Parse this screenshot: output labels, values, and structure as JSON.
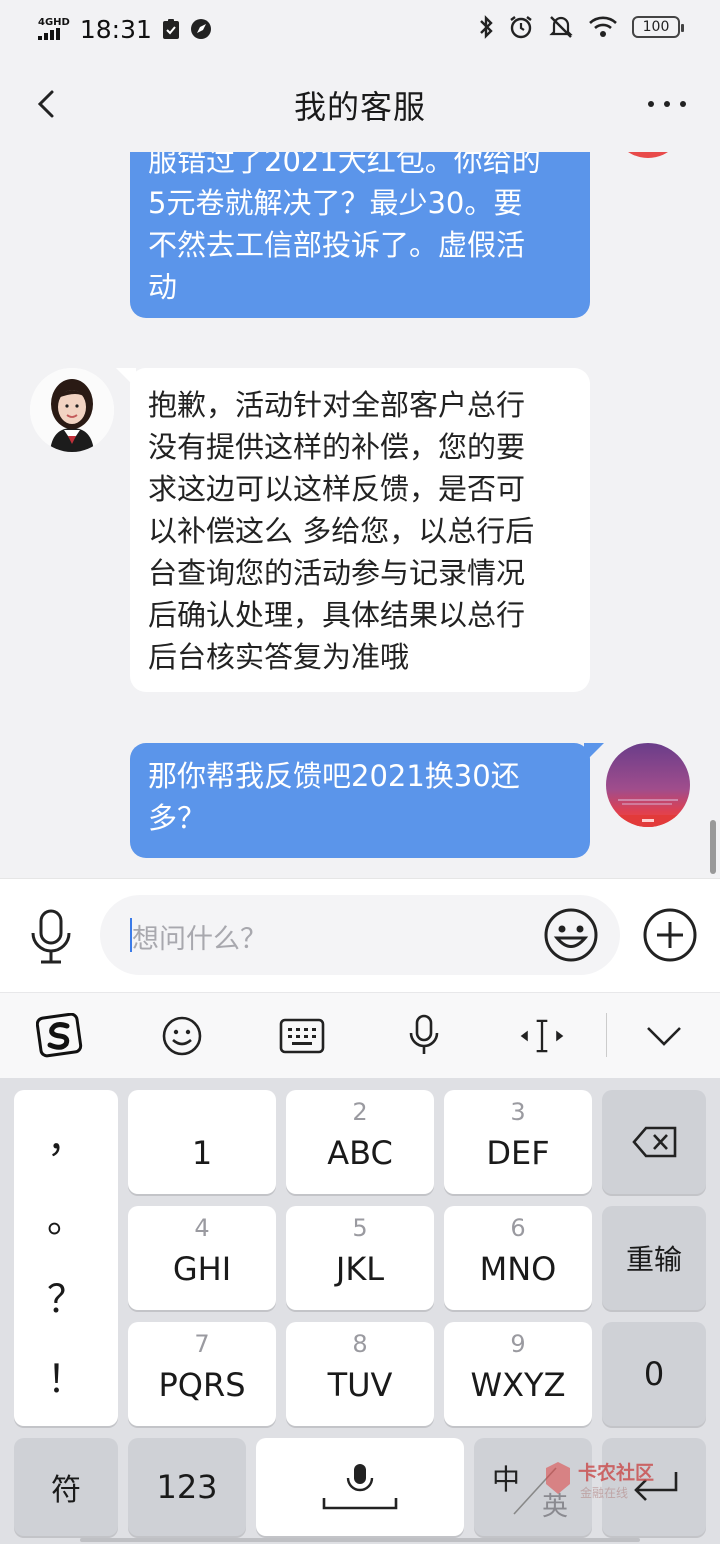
{
  "status_bar": {
    "network": "4GHD",
    "time": "18:31",
    "battery": "100"
  },
  "header": {
    "title": "我的客服"
  },
  "messages": [
    {
      "sender": "user",
      "lines": [
        "服错过了2021大红包。你给的",
        "5元卷就解决了？最少30。要",
        "不然去工信部投诉了。虚假活",
        "动"
      ]
    },
    {
      "sender": "agent",
      "lines": [
        "抱歉，活动针对全部客户总行",
        "没有提供这样的补偿，您的要",
        "求这边可以这样反馈，是否可",
        "以补偿这么 多给您，以总行后",
        "台查询您的活动参与记录情况",
        "后确认处理，具体结果以总行",
        "后台核实答复为准哦"
      ]
    },
    {
      "sender": "user",
      "lines": [
        "那你帮我反馈吧2021换30还",
        "多？"
      ]
    }
  ],
  "input": {
    "placeholder": "想问什么？"
  },
  "keyboard": {
    "punctuation": [
      "，",
      "。",
      "？",
      "！"
    ],
    "keys": [
      {
        "num": "",
        "letters": "1"
      },
      {
        "num": "2",
        "letters": "ABC"
      },
      {
        "num": "3",
        "letters": "DEF"
      },
      {
        "num": "4",
        "letters": "GHI"
      },
      {
        "num": "5",
        "letters": "JKL"
      },
      {
        "num": "6",
        "letters": "MNO"
      },
      {
        "num": "7",
        "letters": "PQRS"
      },
      {
        "num": "8",
        "letters": "TUV"
      },
      {
        "num": "9",
        "letters": "WXYZ"
      }
    ],
    "reinput": "重输",
    "zero": "0",
    "symbols": "符",
    "numbers": "123",
    "lang_zh": "中",
    "lang_en": "英"
  },
  "watermark": {
    "title": "卡农社区",
    "subtitle": "金融在线"
  }
}
